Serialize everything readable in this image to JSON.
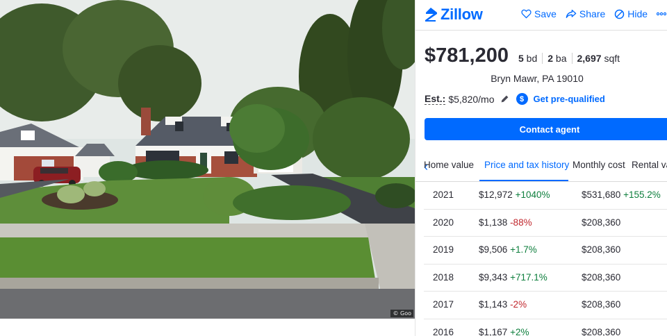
{
  "photo": {
    "credit": "© Goo"
  },
  "header": {
    "logo_text": "Zillow",
    "actions": [
      {
        "label": "Save",
        "icon": "heart-icon"
      },
      {
        "label": "Share",
        "icon": "share-icon"
      },
      {
        "label": "Hide",
        "icon": "hide-icon"
      },
      {
        "label": "M",
        "icon": "more-icon"
      }
    ]
  },
  "listing": {
    "price": "$781,200",
    "beds_value": "5",
    "beds_unit": "bd",
    "baths_value": "2",
    "baths_unit": "ba",
    "sqft_value": "2,697",
    "sqft_unit": "sqft",
    "address": "Bryn Mawr, PA 19010",
    "est_label": "Est.:",
    "est_value": "$5,820/mo",
    "prequal_label": "Get pre-qualified",
    "contact_label": "Contact agent"
  },
  "tabs": [
    {
      "label": "Home value"
    },
    {
      "label": "Price and tax history",
      "active": true
    },
    {
      "label": "Monthly cost"
    },
    {
      "label": "Rental value"
    }
  ],
  "tax_history": [
    {
      "year": "2021",
      "tax": "$12,972",
      "tax_change": "+1040%",
      "direction": "up",
      "assessment": "$531,680",
      "assessment_change": "+155.2%"
    },
    {
      "year": "2020",
      "tax": "$1,138",
      "tax_change": "-88%",
      "direction": "down",
      "assessment": "$208,360",
      "assessment_change": ""
    },
    {
      "year": "2019",
      "tax": "$9,506",
      "tax_change": "+1.7%",
      "direction": "up",
      "assessment": "$208,360",
      "assessment_change": ""
    },
    {
      "year": "2018",
      "tax": "$9,343",
      "tax_change": "+717.1%",
      "direction": "up",
      "assessment": "$208,360",
      "assessment_change": ""
    },
    {
      "year": "2017",
      "tax": "$1,143",
      "tax_change": "-2%",
      "direction": "down",
      "assessment": "$208,360",
      "assessment_change": ""
    },
    {
      "year": "2016",
      "tax": "$1,167",
      "tax_change": "+2%",
      "direction": "up",
      "assessment": "$208,360",
      "assessment_change": ""
    }
  ],
  "colors": {
    "brand": "#006aff",
    "positive": "#0d7e3c",
    "negative": "#c1272d"
  }
}
